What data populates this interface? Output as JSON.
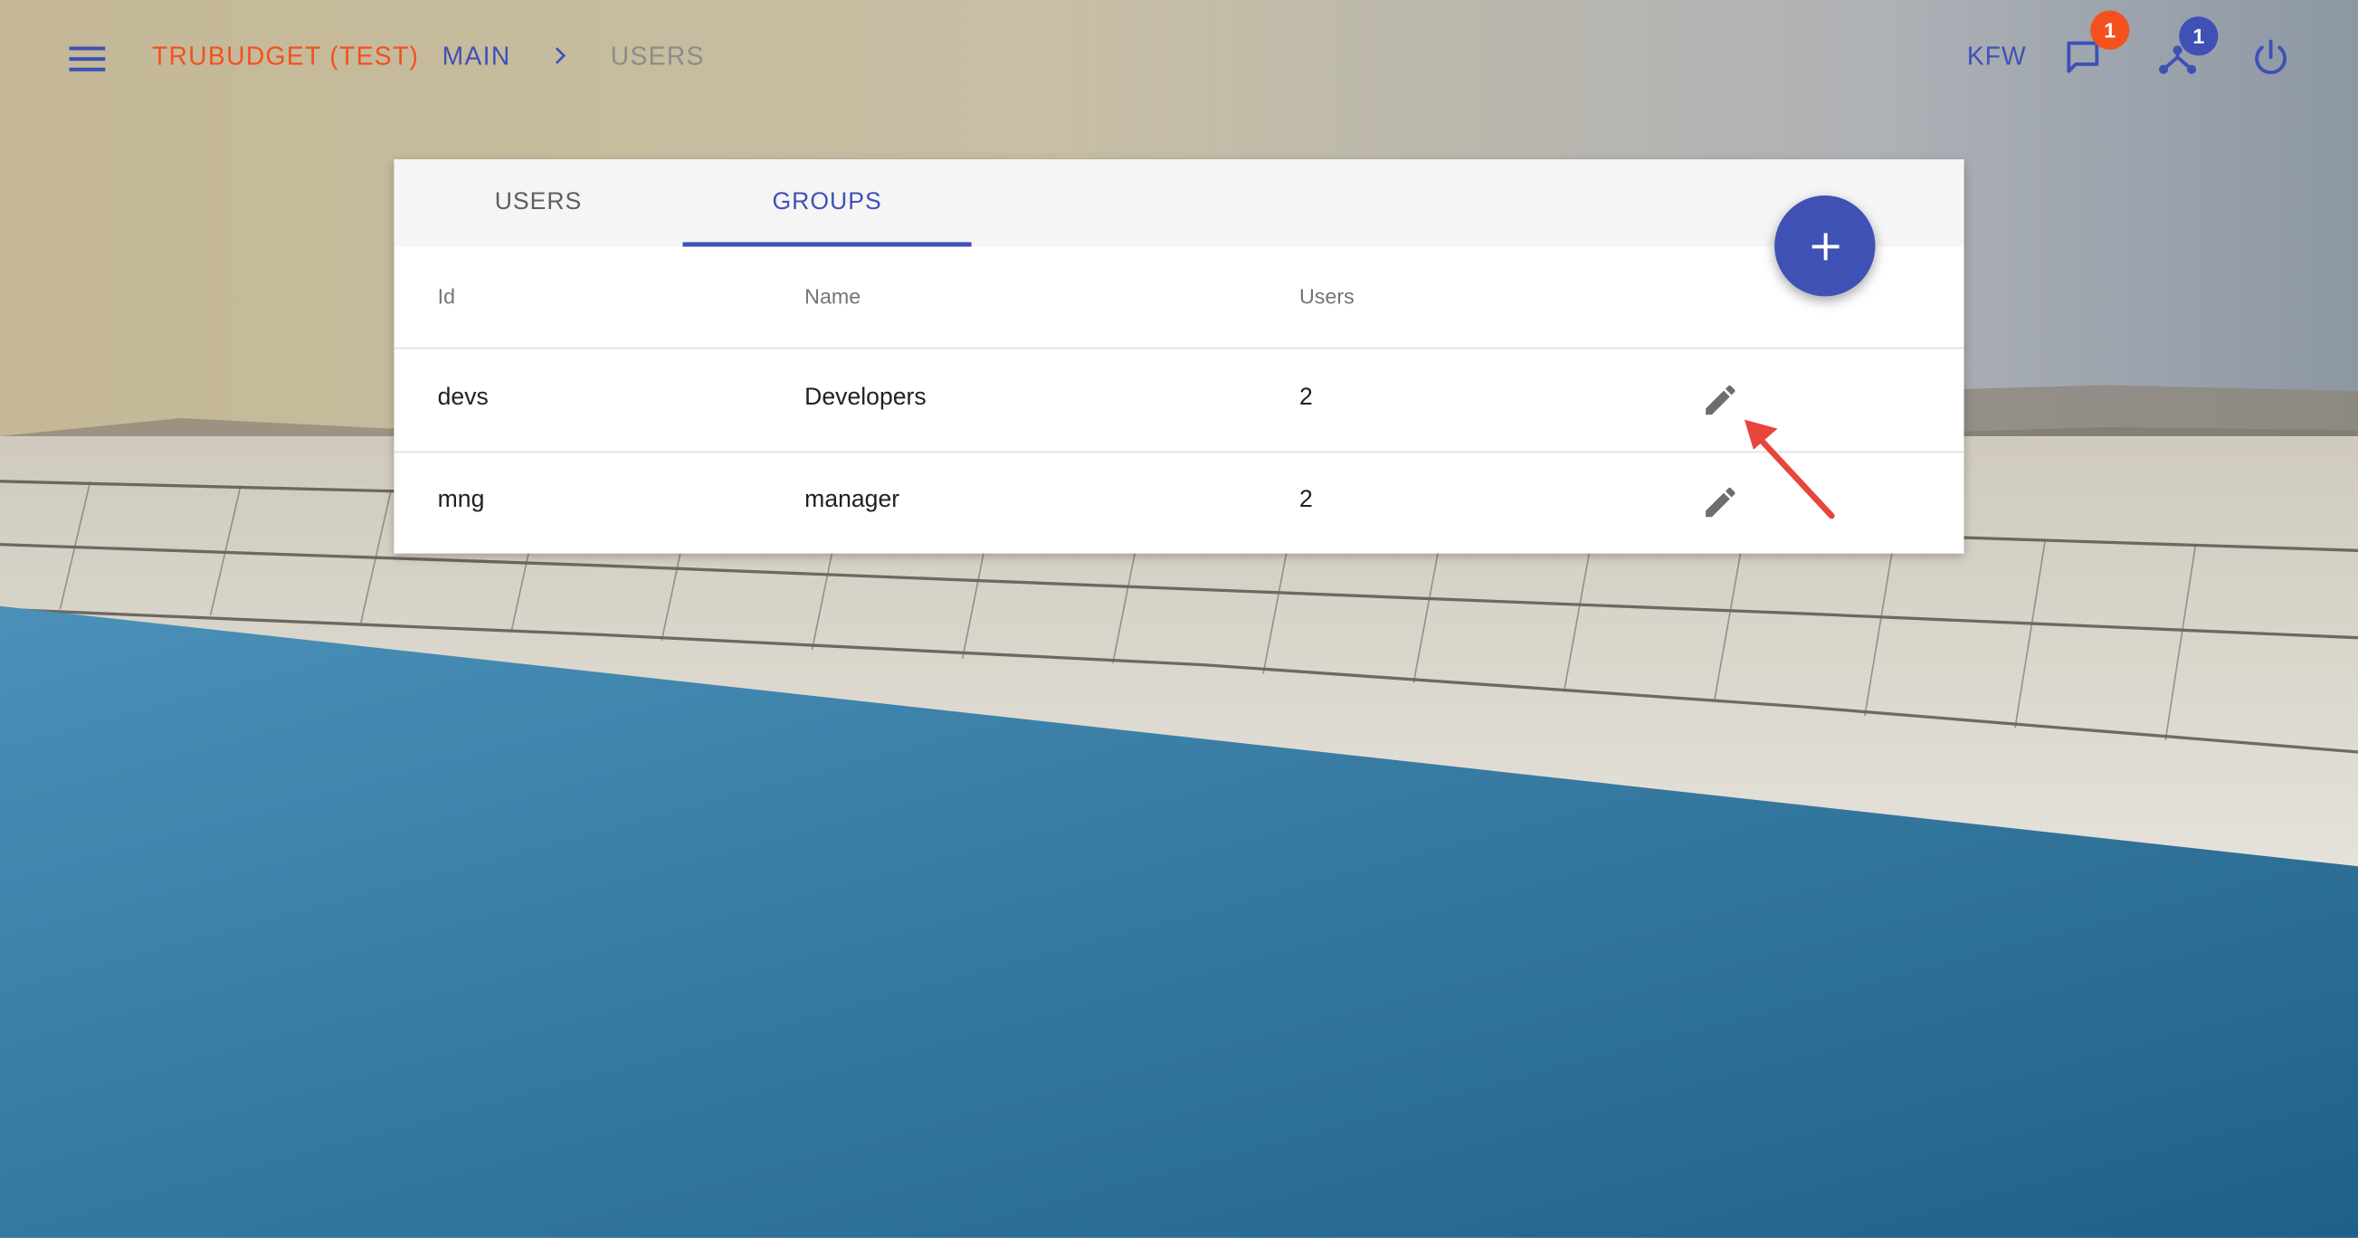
{
  "app": {
    "title": "TRUBUDGET (TEST)"
  },
  "breadcrumb": {
    "main": "MAIN",
    "current": "USERS"
  },
  "header": {
    "organization": "KFW",
    "notifications_count": "1",
    "network_count": "1"
  },
  "tabs": {
    "users": "USERS",
    "groups": "GROUPS",
    "active": "GROUPS"
  },
  "table": {
    "columns": {
      "id": "Id",
      "name": "Name",
      "users": "Users"
    },
    "rows": [
      {
        "id": "devs",
        "name": "Developers",
        "users": "2"
      },
      {
        "id": "mng",
        "name": "manager",
        "users": "2"
      }
    ]
  },
  "colors": {
    "accent": "#3f51b5",
    "title": "#f4511e",
    "badge_notifications": "#f4511e",
    "badge_network": "#3f51b5",
    "annotation_arrow": "#e8453c"
  },
  "icons": {
    "menu": "menu-icon",
    "breadcrumb_separator": "chevron-right-icon",
    "notifications": "chat-icon",
    "network": "network-icon",
    "logout": "power-icon",
    "add": "plus-icon",
    "edit": "pencil-icon"
  }
}
